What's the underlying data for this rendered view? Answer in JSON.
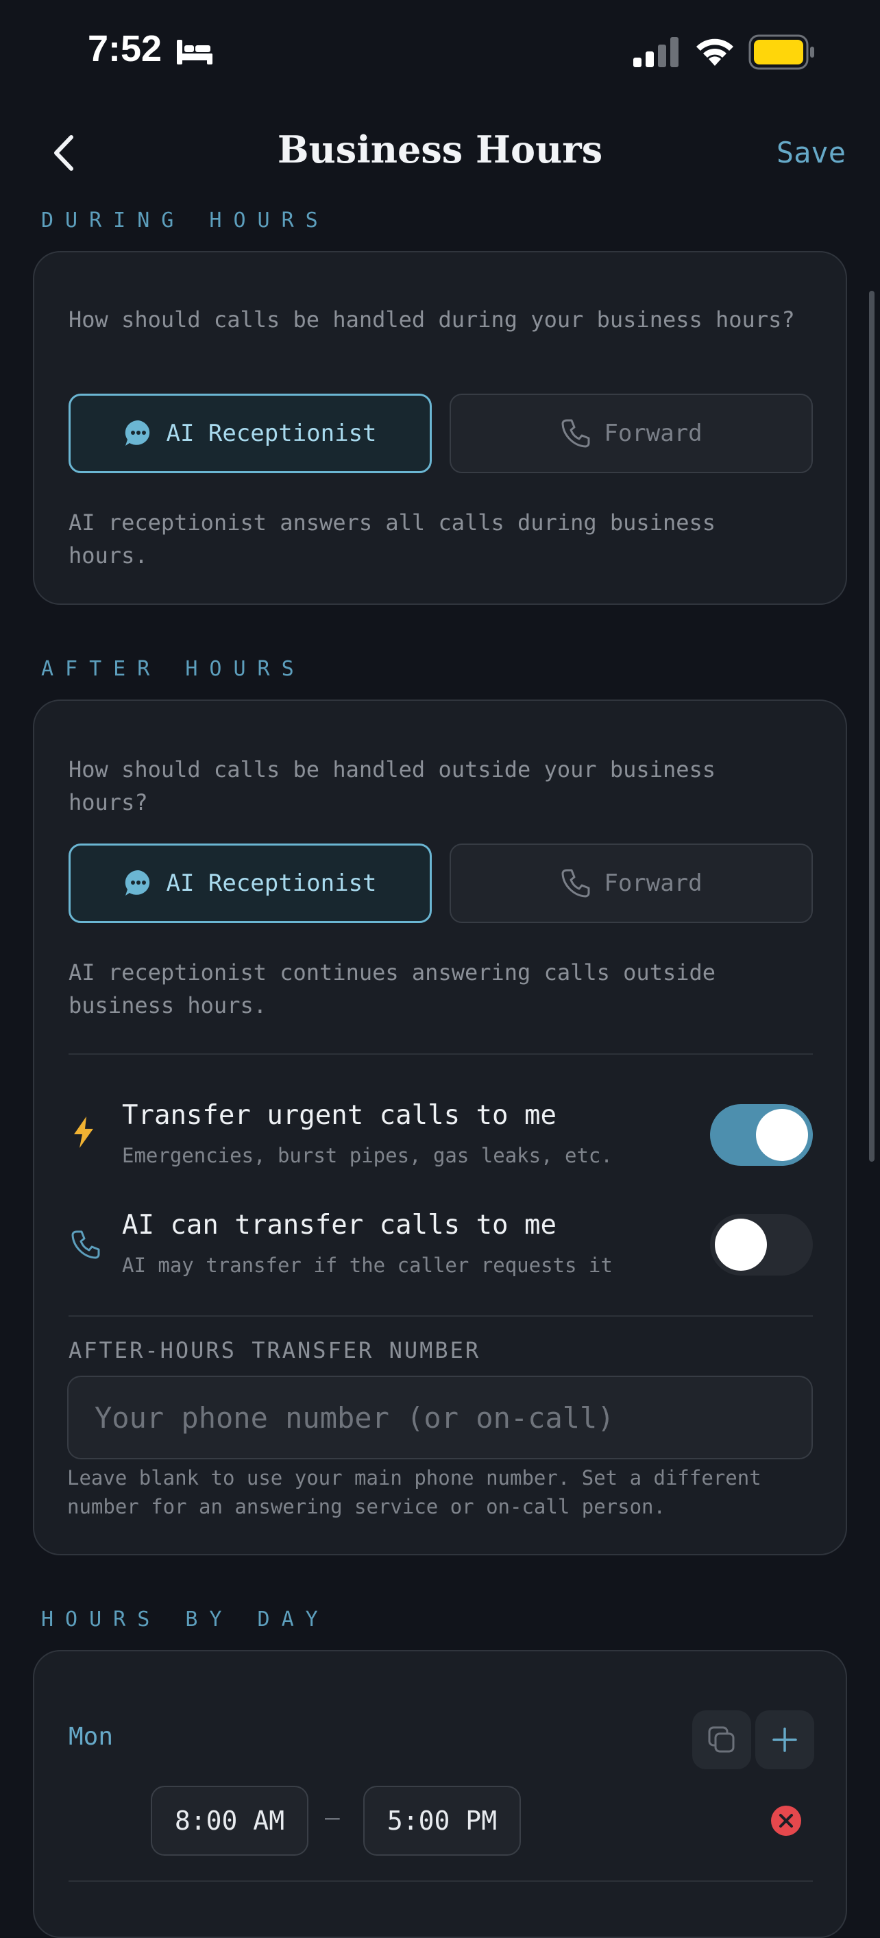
{
  "status_bar": {
    "time": "7:52",
    "sleep_icon": "bed-icon",
    "signal_icon": "cellular-signal-icon",
    "wifi_icon": "wifi-icon",
    "battery_icon": "battery-icon",
    "battery_color": "#ffd60a"
  },
  "nav": {
    "title": "Business Hours",
    "save_label": "Save",
    "back_icon": "chevron-left-icon"
  },
  "during_hours": {
    "section_label": "DURING HOURS",
    "prompt": "How should calls be handled during your business hours?",
    "options": [
      {
        "label": "AI Receptionist",
        "icon": "chat-bubble-icon",
        "selected": true
      },
      {
        "label": "Forward",
        "icon": "phone-icon",
        "selected": false
      }
    ],
    "description": "AI receptionist answers all calls during business hours."
  },
  "after_hours": {
    "section_label": "AFTER HOURS",
    "prompt": "How should calls be handled outside your business hours?",
    "options": [
      {
        "label": "AI Receptionist",
        "icon": "chat-bubble-icon",
        "selected": true
      },
      {
        "label": "Forward",
        "icon": "phone-icon",
        "selected": false
      }
    ],
    "description": "AI receptionist continues answering calls outside business hours.",
    "toggles": [
      {
        "title": "Transfer urgent calls to me",
        "subtitle": "Emergencies, burst pipes, gas leaks, etc.",
        "icon": "lightning-bolt-icon",
        "on": true
      },
      {
        "title": "AI can transfer calls to me",
        "subtitle": "AI may transfer if the caller requests it",
        "icon": "phone-icon",
        "on": false
      }
    ],
    "transfer_number": {
      "label": "AFTER-HOURS TRANSFER NUMBER",
      "value": "",
      "placeholder": "Your phone number (or on-call)",
      "help": "Leave blank to use your main phone number. Set a different number for an answering service or on-call person."
    }
  },
  "hours_by_day": {
    "section_label": "HOURS BY DAY",
    "days": [
      {
        "day": "Mon",
        "start": "8:00 AM",
        "separator": "—",
        "end": "5:00 PM"
      }
    ]
  },
  "colors": {
    "accent": "#66a9c8",
    "background": "#11141b",
    "card": "#1a1e25",
    "bolt": "#f0b232",
    "remove": "#e5484d"
  }
}
